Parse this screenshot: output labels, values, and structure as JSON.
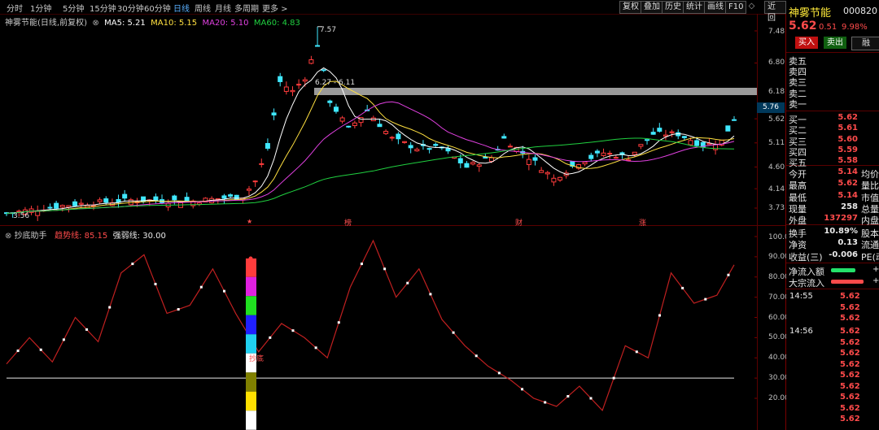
{
  "toolbar": {
    "periods": [
      "分时",
      "1分钟",
      "5分钟",
      "15分钟",
      "30分钟",
      "60分钟",
      "日线",
      "周线",
      "月线",
      "多周期",
      "更多 >"
    ],
    "active_period": "日线",
    "tools": [
      "复权",
      "叠加",
      "历史",
      "统计",
      "画线",
      "F10"
    ],
    "right_tools": [
      "◇",
      "近回"
    ]
  },
  "main": {
    "stock_label": "神雾节能(日线,前复权)",
    "ma": [
      {
        "label": "MA5: 5.21",
        "color": "#ffffff"
      },
      {
        "label": "MA10: 5.15",
        "color": "#ffe040"
      },
      {
        "label": "MA20: 5.10",
        "color": "#e040e0"
      },
      {
        "label": "MA60: 4.83",
        "color": "#20d040"
      }
    ],
    "axis_ticks": [
      "7.48",
      "6.80",
      "6.18",
      "5.62",
      "5.11",
      "4.60",
      "4.14",
      "3.73"
    ],
    "price_tag": "5.76",
    "annotation_high": "7.57",
    "annotation_low": "3.56",
    "annotation_range": "6.27 - 6.11",
    "event_markers": [
      "★",
      "榜",
      "财",
      "涨"
    ]
  },
  "indicator": {
    "name": "抄底助手",
    "line1_label": "趋势线: 85.15",
    "line2_label": "强弱线: 30.00",
    "signal_label": "抄底",
    "axis_ticks": [
      "100.0",
      "90.00",
      "80.00",
      "70.00",
      "60.00",
      "50.00",
      "40.00",
      "30.00",
      "20.00"
    ]
  },
  "right_panel": {
    "name": "神雾节能",
    "code": "000820",
    "price": "5.62",
    "change": "0.51",
    "change_pct": "9.98%",
    "buy_btn": "买入",
    "sell_btn": "卖出",
    "third_btn": "融",
    "asks": [
      "卖五",
      "卖四",
      "卖三",
      "卖二",
      "卖一"
    ],
    "bids": [
      {
        "label": "买一",
        "price": "5.62",
        "vol": ""
      },
      {
        "label": "买二",
        "price": "5.61",
        "vol": ""
      },
      {
        "label": "买三",
        "price": "5.60",
        "vol": ""
      },
      {
        "label": "买四",
        "price": "5.59",
        "vol": ""
      },
      {
        "label": "买五",
        "price": "5.58",
        "vol": ""
      }
    ],
    "stats": [
      {
        "label": "今开",
        "value": "5.14",
        "tail": "均价"
      },
      {
        "label": "最高",
        "value": "5.62",
        "tail": "量比"
      },
      {
        "label": "最低",
        "value": "5.14",
        "tail": "市值"
      },
      {
        "label": "现量",
        "value": "258",
        "tail": "总量"
      },
      {
        "label": "外盘",
        "value": "137297",
        "tail": "内盘"
      }
    ],
    "finance": [
      {
        "label": "换手",
        "value": "10.89%",
        "tail": "股本"
      },
      {
        "label": "净资",
        "value": "0.13",
        "tail": "流通"
      },
      {
        "label": "收益(三)",
        "value": "-0.006",
        "tail": "PE(动"
      }
    ],
    "flow": [
      {
        "label": "净流入额",
        "color": "#24e06a",
        "sign": "+"
      },
      {
        "label": "大宗流入",
        "color": "#ff4b4b",
        "sign": "+"
      }
    ],
    "ticks": [
      {
        "time": "14:55",
        "prices": [
          "5.62",
          "5.62",
          "5.62"
        ]
      },
      {
        "time": "14:56",
        "prices": [
          "5.62",
          "5.62",
          "5.62",
          "5.62",
          "5.62",
          "5.62",
          "5.62",
          "5.62",
          "5.62"
        ]
      }
    ]
  }
}
